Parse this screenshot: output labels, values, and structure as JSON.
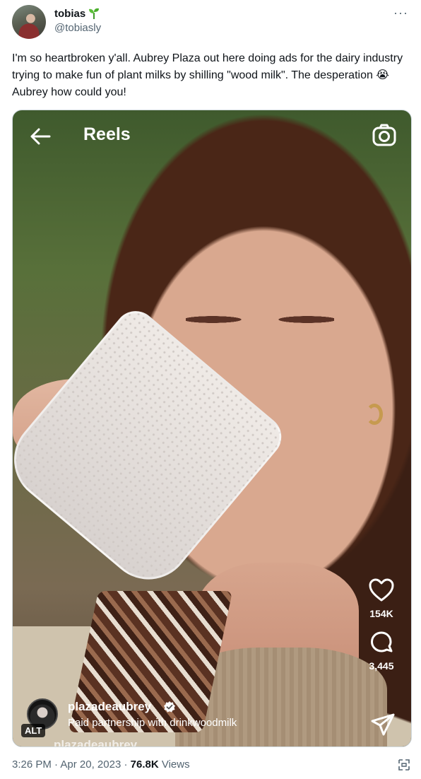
{
  "author": {
    "display_name": "tobias",
    "handle": "@tobiasly",
    "name_emoji_icon": "seedling-icon"
  },
  "more_menu": {
    "label": "···"
  },
  "tweet": {
    "text": "I'm so heartbroken y'all. Aubrey Plaza out here doing ads for the dairy industry trying to make fun of plant milks by shilling \"wood milk\". The desperation 😭 Aubrey how could you!"
  },
  "media": {
    "header_title": "Reels",
    "likes": "154K",
    "comments": "3,445",
    "creator_name": "plazadeaubrey",
    "partnership_prefix": "Paid partnership with ",
    "partner": "drinkwoodmilk",
    "alt_label": "ALT",
    "peek_text": "plazadeaubrey"
  },
  "meta": {
    "time": "3:26 PM",
    "separator": " · ",
    "date": "Apr 20, 2023",
    "views_count": "76.8K",
    "views_label": " Views"
  },
  "colors": {
    "text_primary": "#0f1419",
    "text_secondary": "#536471",
    "border": "#cfd9de"
  }
}
